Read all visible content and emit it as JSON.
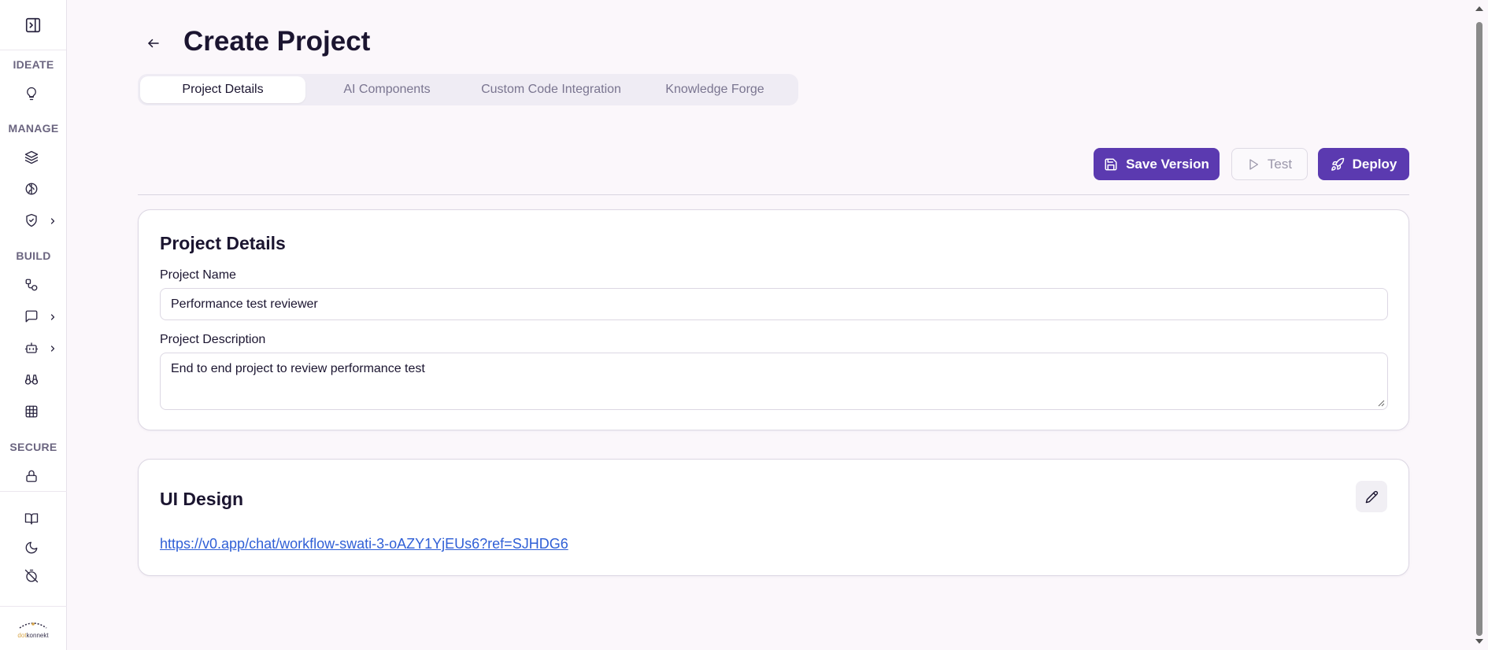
{
  "sidebar": {
    "toggle_icon": "sidebar-expand-icon",
    "sections": {
      "ideate": "IDEATE",
      "manage": "MANAGE",
      "build": "BUILD",
      "secure": "SECURE"
    },
    "icons": {
      "ideate": [
        "lightbulb-icon"
      ],
      "manage": [
        "layers-icon",
        "brain-icon",
        "shield-check-icon"
      ],
      "build": [
        "workflow-icon",
        "chat-icon",
        "bot-icon",
        "binoculars-icon",
        "grid-icon"
      ],
      "secure": [
        "lock-icon"
      ],
      "bottom": [
        "book-icon",
        "moon-icon",
        "timer-off-icon"
      ]
    },
    "logo": {
      "prefix": "dot",
      "rest": "konnekt"
    }
  },
  "header": {
    "title": "Create Project"
  },
  "tabs": [
    {
      "label": "Project Details",
      "active": true
    },
    {
      "label": "AI Components",
      "active": false
    },
    {
      "label": "Custom Code Integration",
      "active": false
    },
    {
      "label": "Knowledge Forge",
      "active": false
    }
  ],
  "actions": {
    "save": "Save Version",
    "test": "Test",
    "deploy": "Deploy"
  },
  "details_card": {
    "title": "Project Details",
    "name_label": "Project Name",
    "name_value": "Performance test reviewer",
    "description_label": "Project Description",
    "description_value": "End to end project to review performance test"
  },
  "ui_design_card": {
    "title": "UI Design",
    "link": "https://v0.app/chat/workflow-swati-3-oAZY1YjEUs6?ref=SJHDG6"
  },
  "colors": {
    "primary": "#5b3ab0",
    "background": "#fbf7fb",
    "link": "#2f5fd6"
  }
}
